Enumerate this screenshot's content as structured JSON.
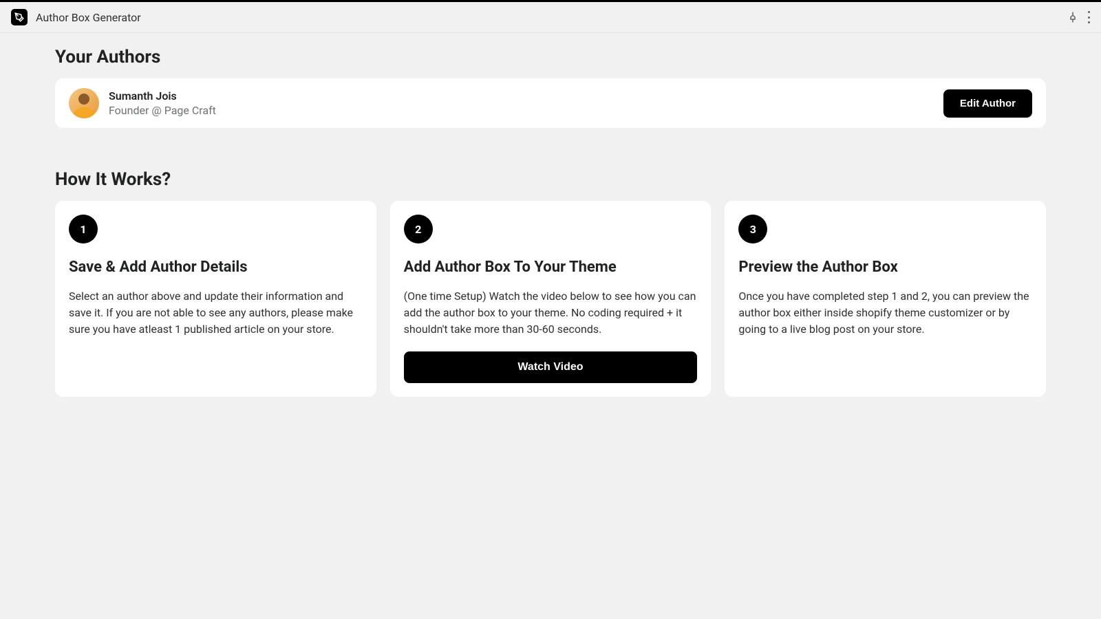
{
  "header": {
    "app_title": "Author Box Generator"
  },
  "sections": {
    "authors_title": "Your Authors",
    "how_it_works_title": "How It Works?"
  },
  "author": {
    "name": "Sumanth Jois",
    "role": "Founder @ Page Craft",
    "edit_button_label": "Edit Author"
  },
  "steps": [
    {
      "number": "1",
      "title": "Save & Add Author Details",
      "description": "Select an author above and update their information and save it. If you are not able to see any authors, please make sure you have atleast 1 published article on your store."
    },
    {
      "number": "2",
      "title": "Add Author Box To Your Theme",
      "description": "(One time Setup) Watch the video below to see how you can add the author box to your theme. No coding required + it shouldn't take more than 30-60 seconds.",
      "button_label": "Watch Video"
    },
    {
      "number": "3",
      "title": "Preview the Author Box",
      "description": "Once you have completed step 1 and 2, you can preview the author box either inside shopify theme customizer or by going to a live blog post on your store."
    }
  ]
}
